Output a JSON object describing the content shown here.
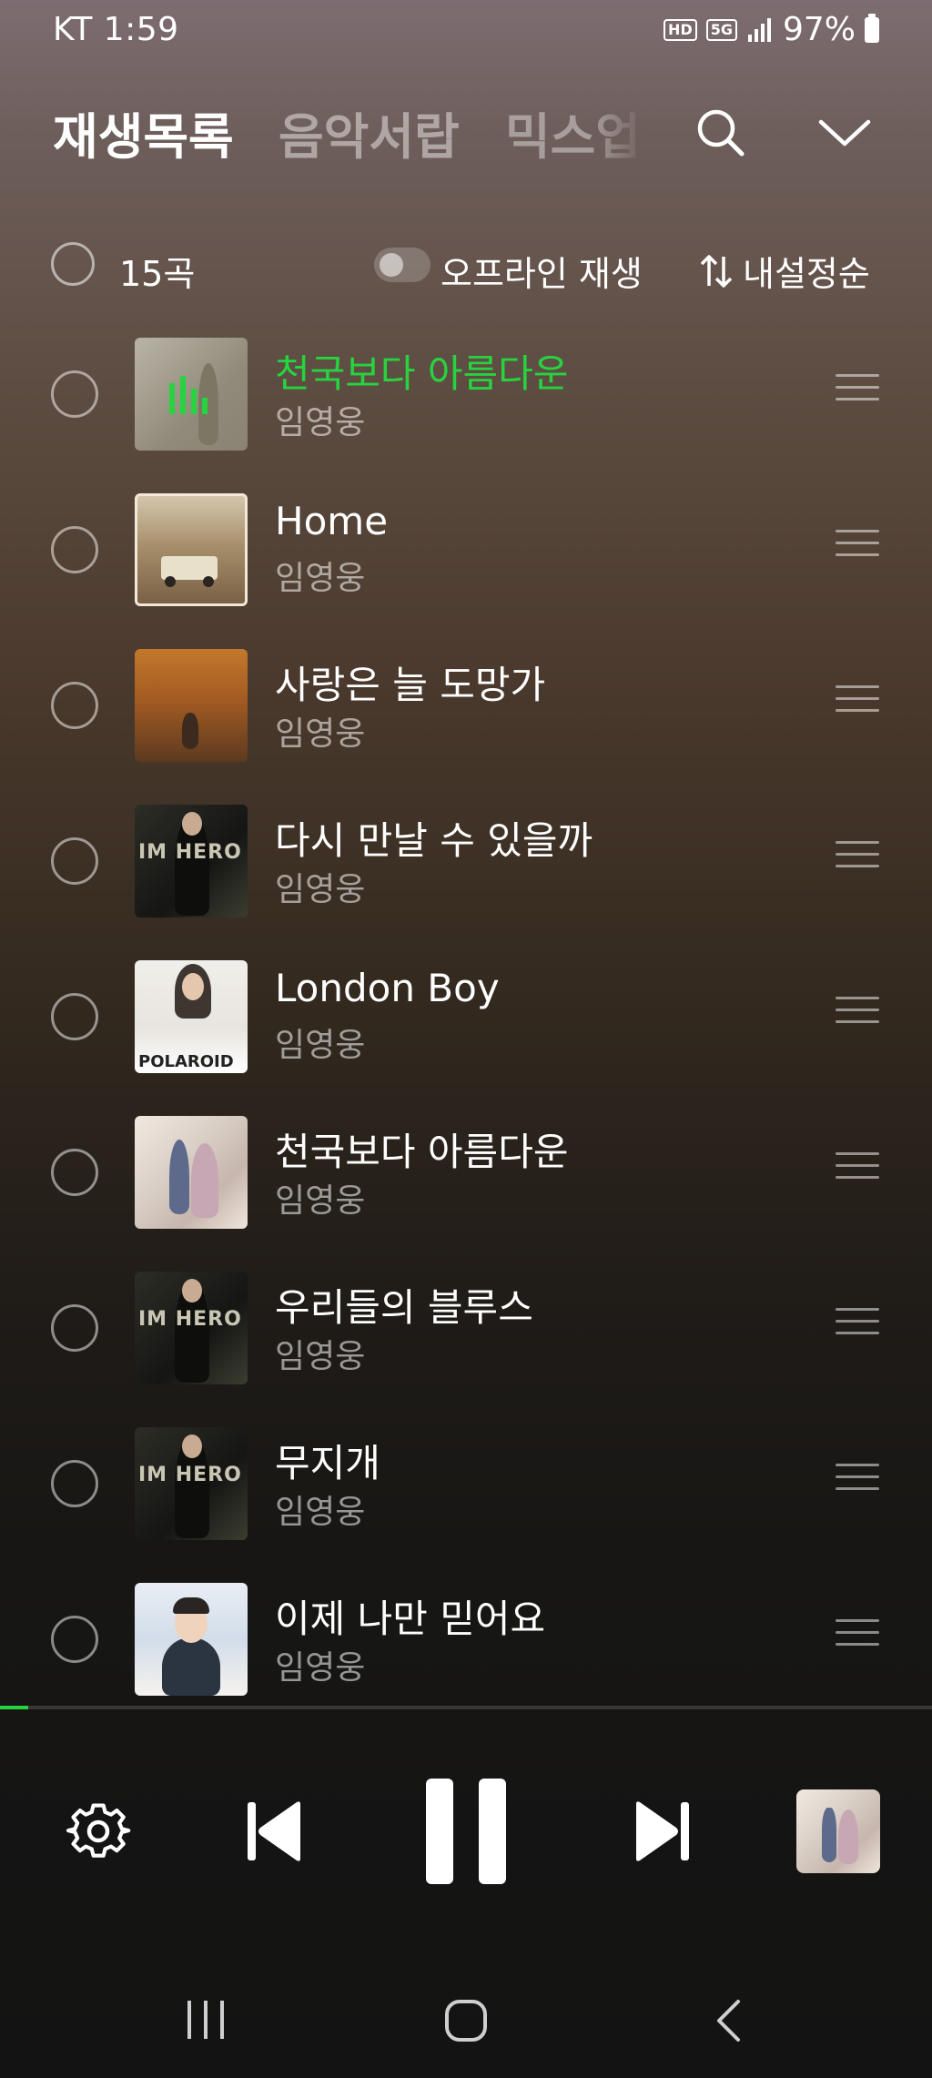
{
  "status_bar": {
    "carrier_time": "KT 1:59",
    "hd_badge": "HD",
    "network_badge": "5G",
    "battery": "97%"
  },
  "header": {
    "tabs": [
      {
        "label": "재생목록",
        "active": true
      },
      {
        "label": "음악서랍",
        "active": false
      },
      {
        "label": "믹스업",
        "active": false
      }
    ],
    "icons": [
      "search-icon",
      "chevron-down-icon"
    ]
  },
  "toolbar": {
    "count": "15곡",
    "offline_label": "오프라인 재생",
    "offline_on": false,
    "sort_label": "내설정순"
  },
  "tracks": [
    {
      "title": "천국보다 아름다운",
      "artist": "임영웅",
      "playing": true
    },
    {
      "title": "Home",
      "artist": "임영웅",
      "playing": false
    },
    {
      "title": "사랑은 늘 도망가",
      "artist": "임영웅",
      "playing": false
    },
    {
      "title": "다시 만날 수 있을까",
      "artist": "임영웅",
      "playing": false,
      "art_text": "IM HERO"
    },
    {
      "title": "London Boy",
      "artist": "임영웅",
      "playing": false,
      "art_text": "POLAROID"
    },
    {
      "title": "천국보다 아름다운",
      "artist": "임영웅",
      "playing": false
    },
    {
      "title": "우리들의 블루스",
      "artist": "임영웅",
      "playing": false,
      "art_text": "IM HERO"
    },
    {
      "title": "무지개",
      "artist": "임영웅",
      "playing": false,
      "art_text": "IM HERO"
    },
    {
      "title": "이제 나만 믿어요",
      "artist": "임영웅",
      "playing": false
    }
  ],
  "player": {
    "progress": 0.03,
    "state": "playing",
    "accent": "#27d33f"
  },
  "colors": {
    "accent_green": "#27d33f",
    "background_dark": "#131313"
  }
}
